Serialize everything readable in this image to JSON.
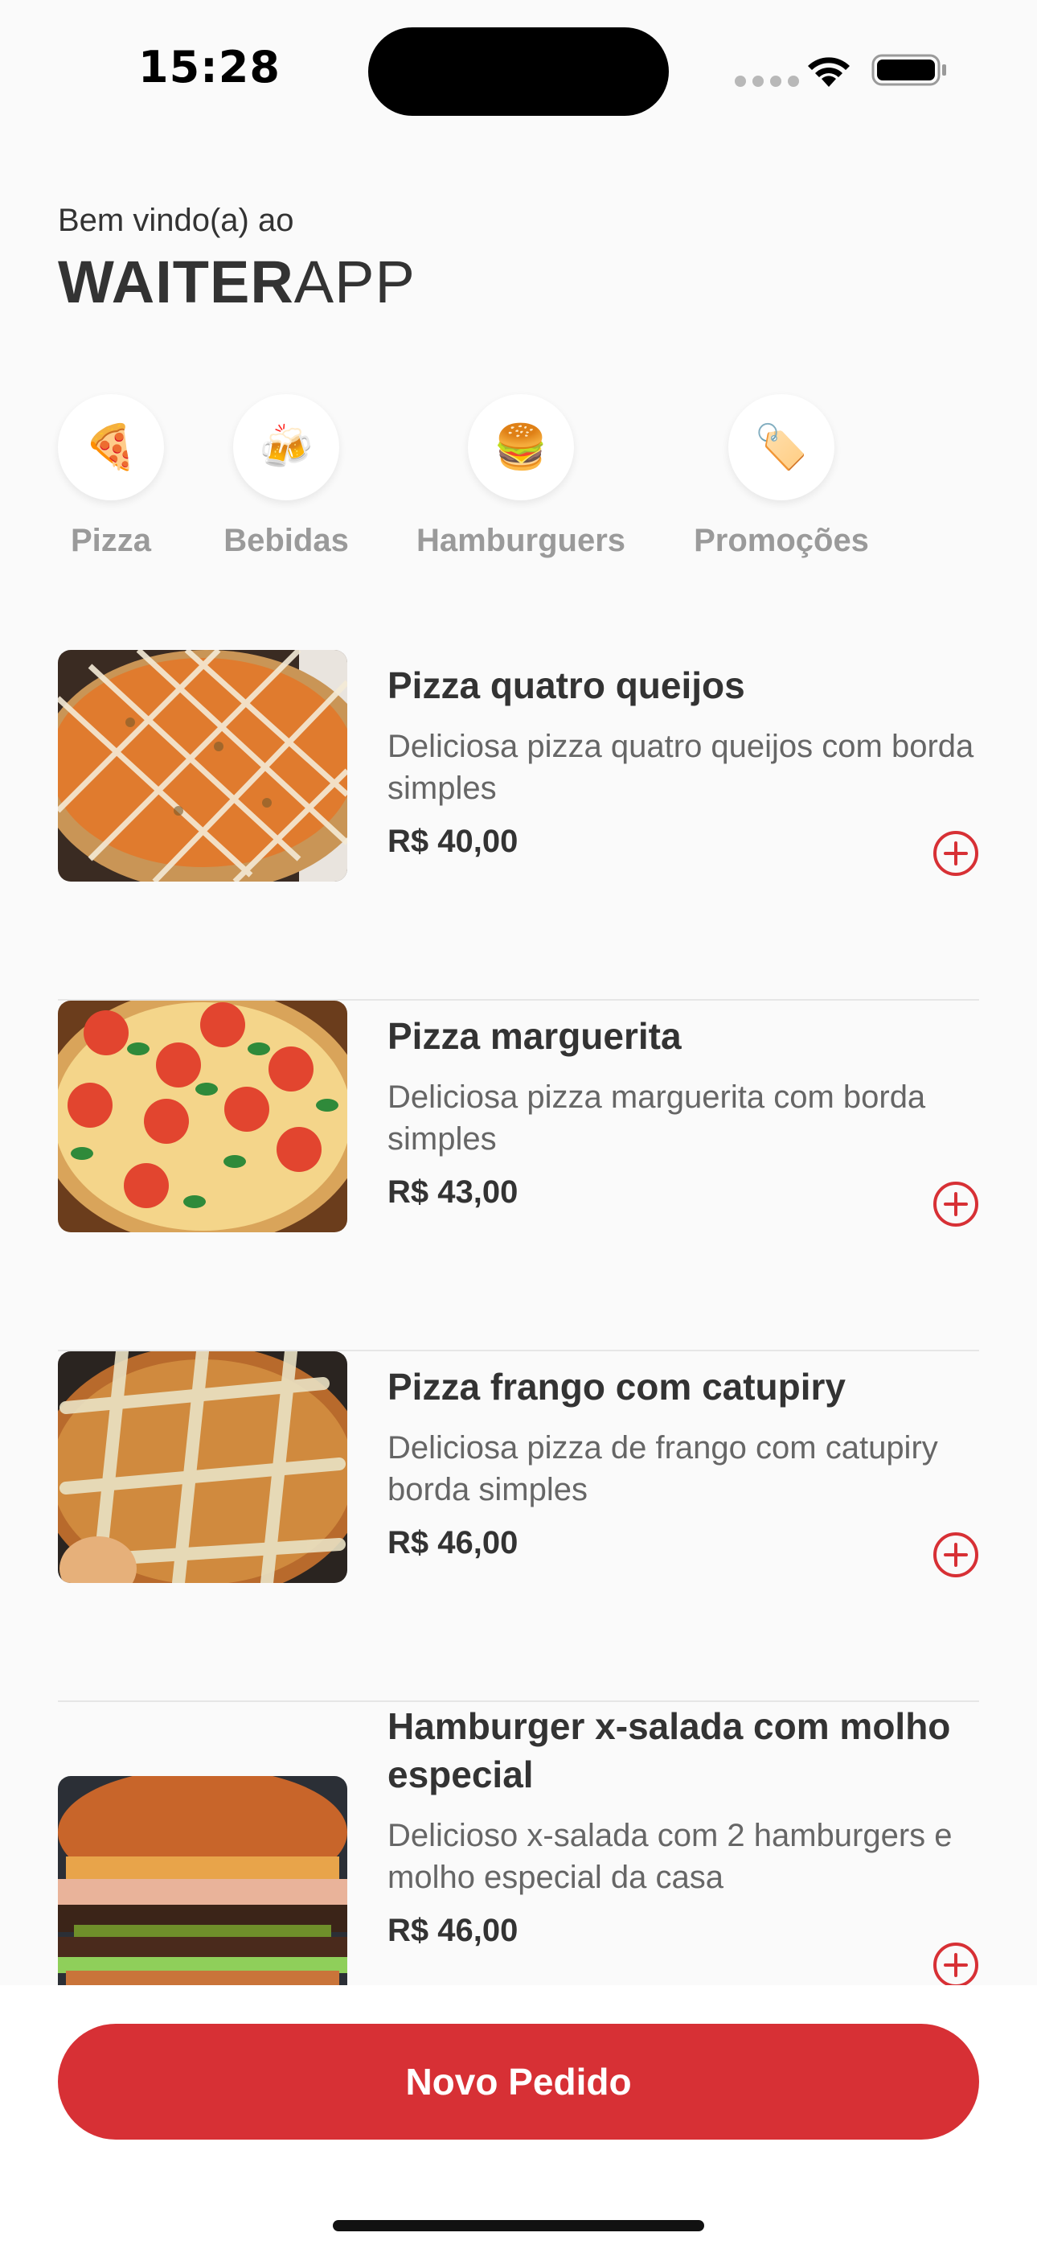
{
  "status_bar": {
    "time": "15:28"
  },
  "header": {
    "greeting": "Bem vindo(a) ao",
    "brand_bold": "WAITER",
    "brand_light": "APP"
  },
  "categories": [
    {
      "label": "Pizza",
      "icon": "🍕"
    },
    {
      "label": "Bebidas",
      "icon": "🍻"
    },
    {
      "label": "Hamburguers",
      "icon": "🍔"
    },
    {
      "label": "Promoções",
      "icon": "🏷️"
    }
  ],
  "products": [
    {
      "name": "Pizza quatro queijos",
      "description": "Deliciosa pizza quatro queijos com borda simples",
      "price": "R$ 40,00",
      "image": "pizza-quatro-queijos"
    },
    {
      "name": "Pizza marguerita",
      "description": "Deliciosa pizza marguerita com borda simples",
      "price": "R$ 43,00",
      "image": "pizza-marguerita"
    },
    {
      "name": "Pizza frango com catupiry",
      "description": "Deliciosa pizza de frango com catupiry borda simples",
      "price": "R$ 46,00",
      "image": "pizza-frango"
    },
    {
      "name": "Hamburger x-salada com molho especial",
      "description": "Delicioso x-salada com 2 hamburgers e molho especial da casa",
      "price": "R$ 46,00",
      "image": "hamburger"
    }
  ],
  "footer": {
    "button_label": "Novo Pedido"
  },
  "colors": {
    "accent": "#d73035",
    "text": "#333333",
    "muted": "#666666",
    "background": "#fafafa"
  }
}
